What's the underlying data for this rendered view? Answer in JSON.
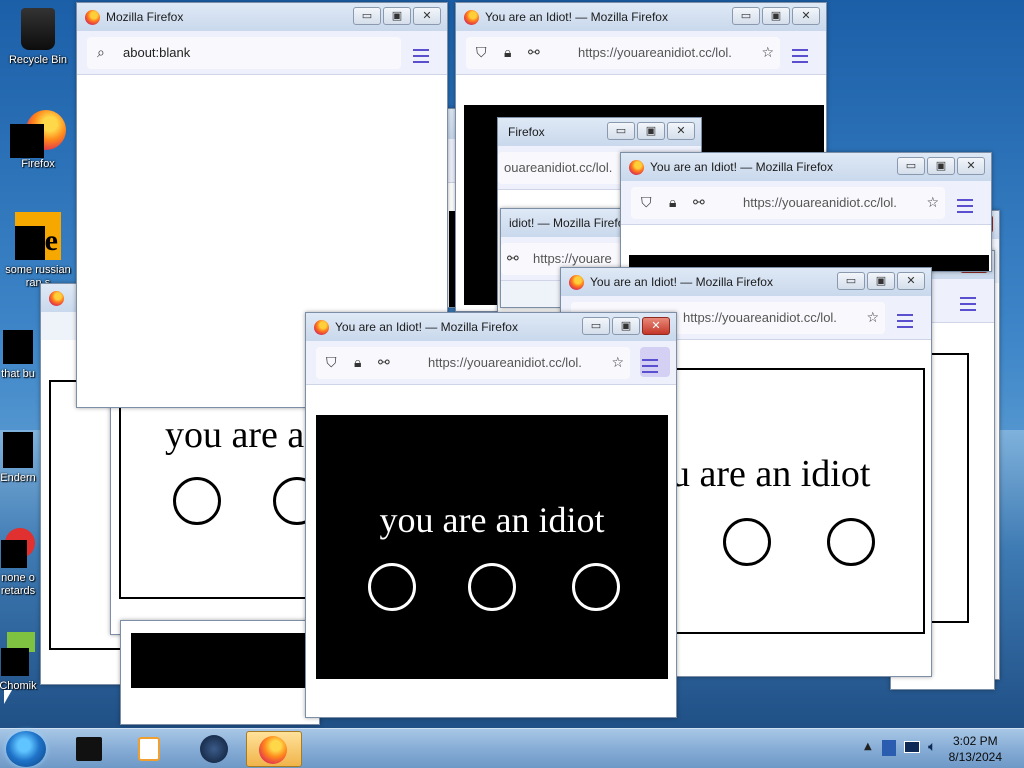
{
  "desktop": {
    "icons": [
      {
        "label": "Recycle Bin"
      },
      {
        "label": "Firefox"
      },
      {
        "label": "some russian"
      },
      {
        "label": "ran.s"
      },
      {
        "label": "that bu"
      },
      {
        "label": "Endern"
      },
      {
        "label": "none o"
      },
      {
        "label": "retards"
      },
      {
        "label": "Chomik"
      }
    ]
  },
  "windows": {
    "blank": {
      "title": "Mozilla Firefox",
      "url": "about:blank"
    },
    "main": {
      "title": "You are an Idiot! — Mozilla Firefox",
      "url": "https://youareanidiot.cc/lol.",
      "text": "you are an idiot"
    },
    "top_right": {
      "title": "You are an Idiot! — Mozilla Firefox",
      "url": "https://youareanidiot.cc/lol."
    },
    "mid_right": {
      "title": "You are an Idiot! — Mozilla Firefox",
      "url": "https://youareanidiot.cc/lol."
    },
    "lower_right": {
      "title": "You are an Idiot! — Mozilla Firefox",
      "url": "https://youareanidiot.cc/lol.",
      "text": "u are an idiot"
    },
    "mid_back": {
      "title": "Firefox",
      "url": "ouareanidiot.cc/lol."
    },
    "mid_back2": {
      "title": "idiot! — Mozilla Firefox",
      "url": "https://youare"
    },
    "left_back": {
      "text": "you are a"
    }
  },
  "taskbar": {
    "time": "3:02 PM",
    "date": "8/13/2024"
  },
  "colors": {
    "menu_accent": "#5a4fcf",
    "taskbar_active": "#f0b44a"
  }
}
